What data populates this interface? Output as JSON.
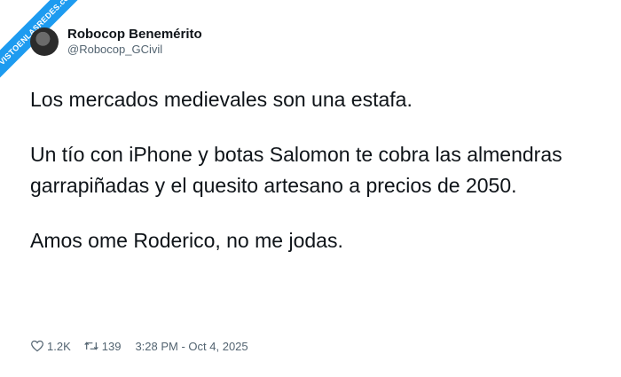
{
  "watermark": {
    "text": "VISTOENLASREDES.com"
  },
  "author": {
    "display_name": "Robocop Benemérito",
    "handle": "@Robocop_GCivil"
  },
  "tweet": {
    "paragraphs": [
      "Los mercados medievales son una estafa.",
      "Un tío con iPhone y botas Salomon te cobra las almendras garrapiñadas y el quesito artesano a precios de 2050.",
      "Amos ome Roderico, no me jodas."
    ]
  },
  "stats": {
    "likes": "1.2K",
    "retweets": "139",
    "timestamp": "3:28 PM - Oct 4, 2025"
  },
  "icons": {
    "like": "heart-icon",
    "retweet": "retweet-icon"
  },
  "colors": {
    "accent": "#1d9bf0",
    "text": "#0f1419",
    "muted": "#536471"
  }
}
